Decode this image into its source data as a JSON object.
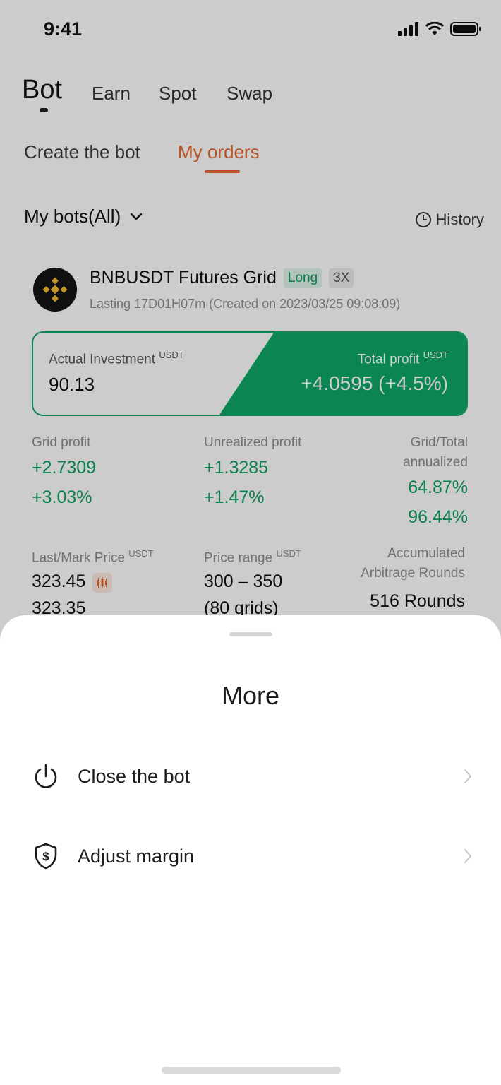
{
  "status": {
    "time": "9:41"
  },
  "top_tabs": [
    {
      "label": "Bot"
    },
    {
      "label": "Earn"
    },
    {
      "label": "Spot"
    },
    {
      "label": "Swap"
    }
  ],
  "sub_tabs": [
    {
      "label": "Create the bot"
    },
    {
      "label": "My orders"
    }
  ],
  "filter": {
    "label": "My bots(All)"
  },
  "history": {
    "label": "History"
  },
  "bot": {
    "name": "BNBUSDT Futures Grid",
    "direction": "Long",
    "leverage": "3X",
    "lasting": "Lasting 17D01H07m (Created on 2023/03/25 09:08:09)",
    "investment_label": "Actual Investment",
    "investment_unit": "USDT",
    "investment_value": "90.13",
    "total_profit_label": "Total profit",
    "total_profit_unit": "USDT",
    "total_profit_value": "+4.0595 (+4.5%)",
    "grid_profit_label": "Grid profit",
    "grid_profit_value": "+2.7309",
    "grid_profit_pct": "+3.03%",
    "unrealized_label": "Unrealized profit",
    "unrealized_value": "+1.3285",
    "unrealized_pct": "+1.47%",
    "annualized_label_1": "Grid/Total",
    "annualized_label_2": "annualized",
    "annualized_grid": "64.87%",
    "annualized_total": "96.44%",
    "last_mark_label": "Last/Mark Price",
    "last_mark_unit": "USDT",
    "last_price": "323.45",
    "mark_price": "323.35",
    "price_range_label": "Price range",
    "price_range_unit": "USDT",
    "price_range_value": "300 – 350",
    "grids": "(80 grids)",
    "arbitrage_label_1": "Accumulated",
    "arbitrage_label_2": "Arbitrage Rounds",
    "arbitrage_value": "516 Rounds"
  },
  "sheet": {
    "title": "More",
    "items": [
      {
        "label": "Close the bot",
        "icon": "power-icon"
      },
      {
        "label": "Adjust margin",
        "icon": "shield-dollar-icon"
      }
    ]
  },
  "colors": {
    "accent": "#e8672c",
    "profit_green": "#10a061",
    "green_block": "#0ea868"
  }
}
